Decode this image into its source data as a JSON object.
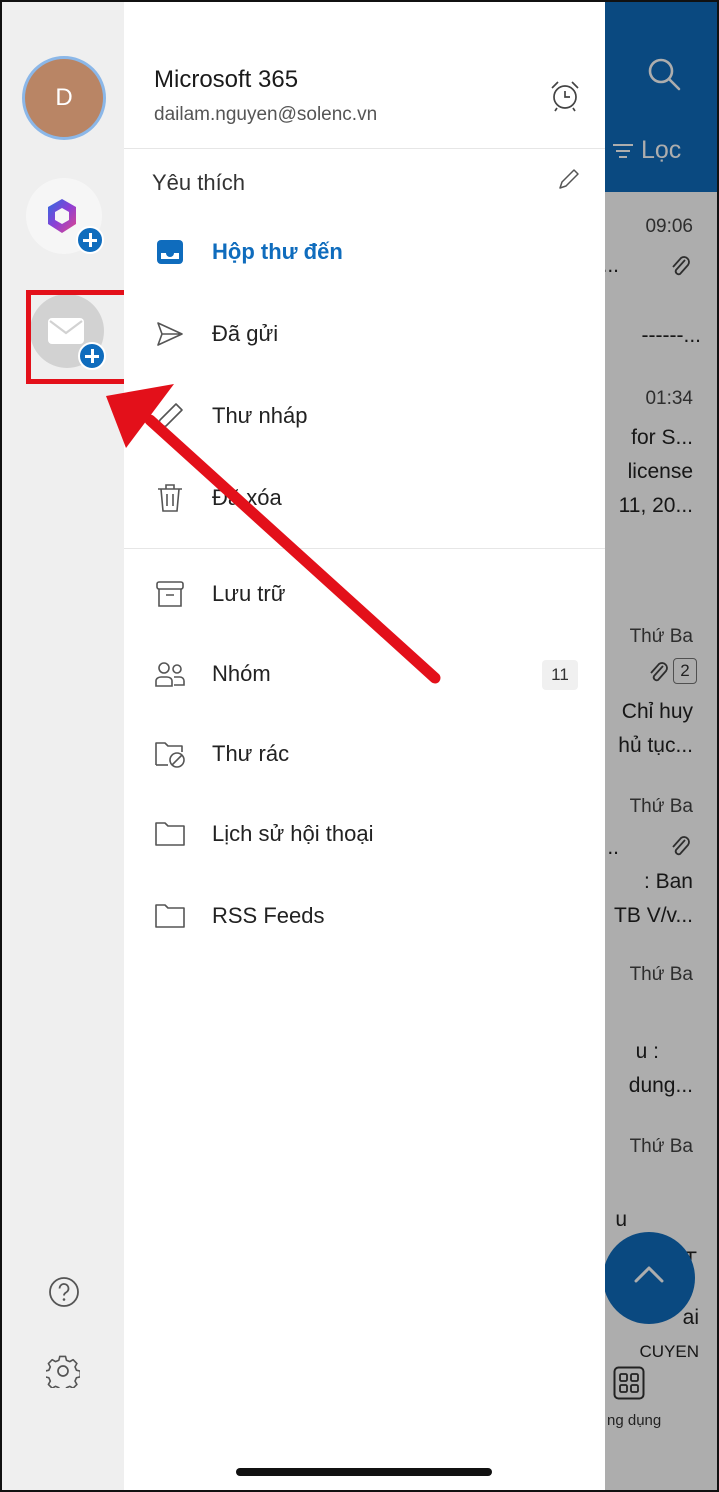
{
  "account": {
    "avatar_initial": "D",
    "name": "Microsoft 365",
    "email": "dailam.nguyen@solenc.vn"
  },
  "favorites": {
    "title": "Yêu thích"
  },
  "folders": [
    {
      "label": "Hộp thư đến",
      "icon": "inbox-icon",
      "active": true
    },
    {
      "label": "Đã gửi",
      "icon": "send-icon"
    },
    {
      "label": "Thư nháp",
      "icon": "draft-pencil-icon"
    },
    {
      "label": "Đã xóa",
      "icon": "trash-icon"
    },
    {
      "label": "Lưu trữ",
      "icon": "archive-icon"
    },
    {
      "label": "Nhóm",
      "icon": "group-icon",
      "count": "11"
    },
    {
      "label": "Thư rác",
      "icon": "junk-folder-icon"
    },
    {
      "label": "Lịch sử hội thoại",
      "icon": "folder-icon"
    },
    {
      "label": "RSS Feeds",
      "icon": "folder-icon"
    }
  ],
  "background_list": {
    "filter_label": "Lọc",
    "fragments": [
      "09:06",
      "...",
      "------...",
      "01:34",
      "for S...",
      "license",
      "11, 20...",
      "Thứ Ba",
      "2",
      "Chỉ huy",
      "hủ tục...",
      "Thứ Ba",
      "..",
      ": Ban",
      "TB V/v...",
      "Thứ Ba",
      "u :",
      "dung...",
      "Thứ Ba",
      "u",
      "T",
      "ai",
      "CUYEN"
    ],
    "apps_label": "ng dụng"
  },
  "colors": {
    "accent": "#0f6cbd",
    "highlight": "#e3101a",
    "rail_bg": "#efefef",
    "avatar_bg": "#b98565"
  }
}
